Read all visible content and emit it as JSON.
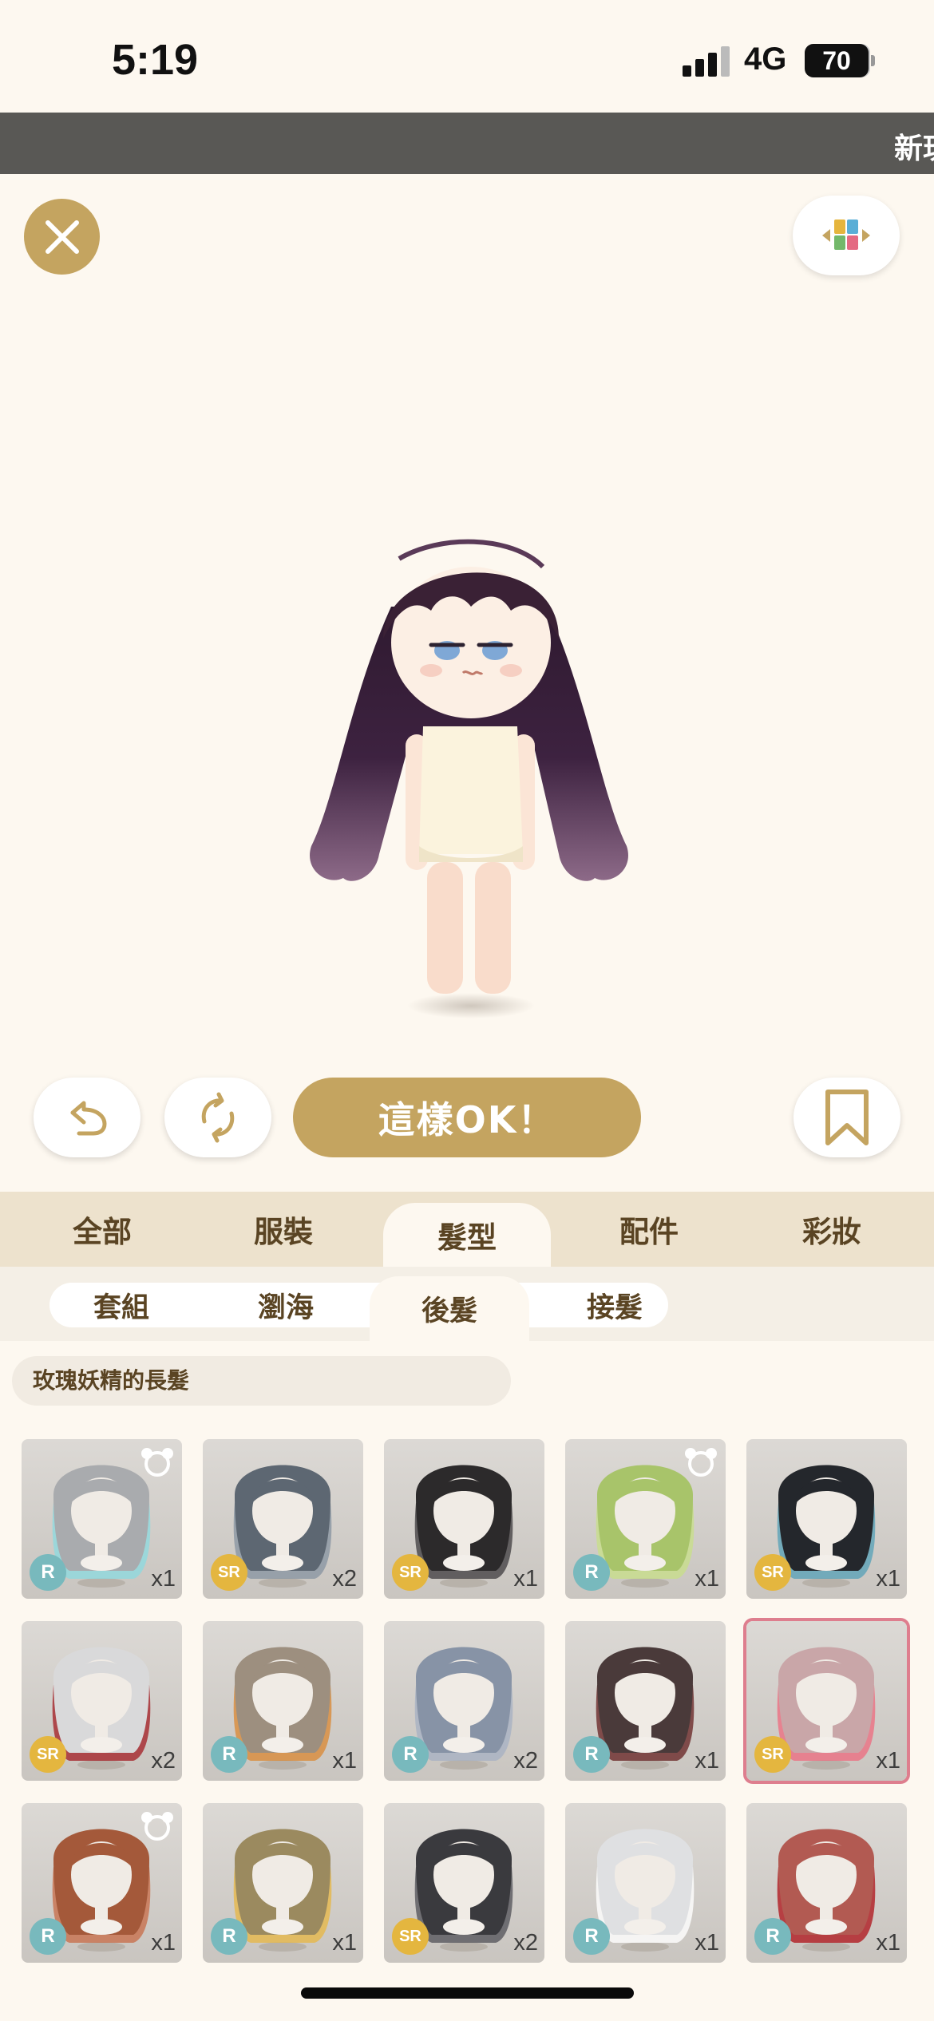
{
  "status_bar": {
    "time": "5:19",
    "network": "4G",
    "battery": "70"
  },
  "ticker": {
    "text": "新玩"
  },
  "top": {
    "close_icon": "close-icon",
    "layout_icon": "layout-grid-icon"
  },
  "actions": {
    "ok_label": "這樣OK！",
    "undo_icon": "undo-icon",
    "refresh_icon": "refresh-icon",
    "bookmark_icon": "bookmark-icon"
  },
  "category_tabs": [
    {
      "label": "全部",
      "active": false
    },
    {
      "label": "服裝",
      "active": false
    },
    {
      "label": "髮型",
      "active": true
    },
    {
      "label": "配件",
      "active": false
    },
    {
      "label": "彩妝",
      "active": false
    }
  ],
  "sub_tabs": [
    {
      "label": "套組",
      "active": false
    },
    {
      "label": "瀏海",
      "active": false
    },
    {
      "label": "後髮",
      "active": true
    },
    {
      "label": "接髮",
      "active": false
    }
  ],
  "selected_item_name": "玫瑰妖精的長髮",
  "items": [
    {
      "rarity": "R",
      "count": "x1",
      "hair": "#a9abae",
      "accent": "#8fd9de",
      "bear": true
    },
    {
      "rarity": "SR",
      "count": "x2",
      "hair": "#5d6772",
      "accent": "#8a96a3",
      "bear": false
    },
    {
      "rarity": "SR",
      "count": "x1",
      "hair": "#2c2a2b",
      "accent": "#464446",
      "bear": false
    },
    {
      "rarity": "R",
      "count": "x1",
      "hair": "#a8c46a",
      "accent": "#c8df8b",
      "bear": true
    },
    {
      "rarity": "SR",
      "count": "x1",
      "hair": "#24272c",
      "accent": "#5ba3b8",
      "bear": false
    },
    {
      "rarity": "SR",
      "count": "x2",
      "hair": "#d9d9da",
      "accent": "#a5262c",
      "bear": false
    },
    {
      "rarity": "R",
      "count": "x1",
      "hair": "#9d8f7f",
      "accent": "#d98b3a",
      "bear": false
    },
    {
      "rarity": "R",
      "count": "x2",
      "hair": "#8793a6",
      "accent": "#a7b2c3",
      "bear": false
    },
    {
      "rarity": "R",
      "count": "x1",
      "hair": "#4a3a3a",
      "accent": "#6b2b2b",
      "bear": false
    },
    {
      "rarity": "SR",
      "count": "x1",
      "hair": "#c9a6a8",
      "accent": "#ec6f82",
      "bear": false,
      "selected": true
    },
    {
      "rarity": "R",
      "count": "x1",
      "hair": "#a4593a",
      "accent": "#c8714d",
      "bear": true
    },
    {
      "rarity": "R",
      "count": "x1",
      "hair": "#9b8a5f",
      "accent": "#e6b84a",
      "bear": false
    },
    {
      "rarity": "SR",
      "count": "x2",
      "hair": "#3a3a3e",
      "accent": "#58585e",
      "bear": false
    },
    {
      "rarity": "R",
      "count": "x1",
      "hair": "#dfe0e2",
      "accent": "#ffffff",
      "bear": false
    },
    {
      "rarity": "R",
      "count": "x1",
      "hair": "#b25a52",
      "accent": "#b01c22",
      "bear": false
    }
  ]
}
